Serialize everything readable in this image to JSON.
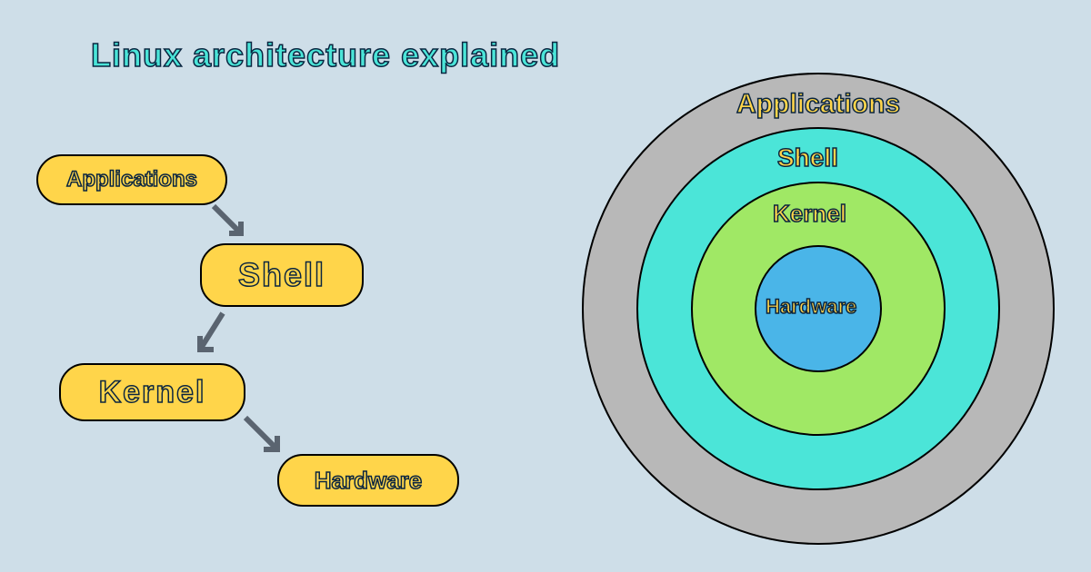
{
  "title": "Linux architecture explained",
  "flow": {
    "nodes": [
      {
        "label": "Applications"
      },
      {
        "label": "Shell"
      },
      {
        "label": "Kernel"
      },
      {
        "label": "Hardware"
      }
    ]
  },
  "rings": {
    "layers": [
      {
        "label": "Applications",
        "color": "#b8b8b8"
      },
      {
        "label": "Shell",
        "color": "#4be5d8"
      },
      {
        "label": "Kernel",
        "color": "#a0e865"
      },
      {
        "label": "Hardware",
        "color": "#4ab5e8"
      }
    ]
  }
}
